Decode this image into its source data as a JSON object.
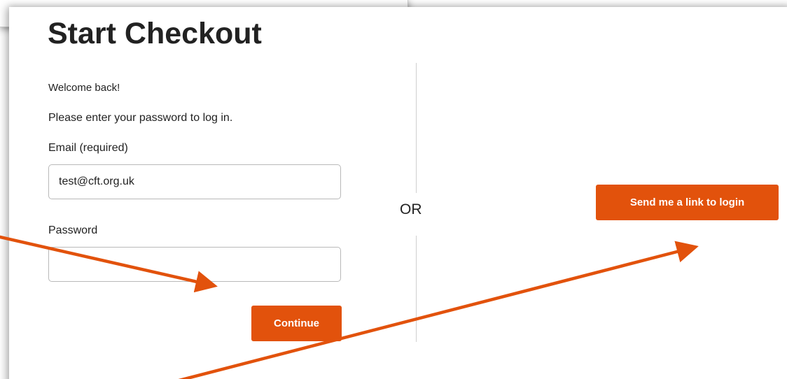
{
  "dialog": {
    "title": "Start Checkout",
    "welcome_text": "Welcome back!",
    "instructions": "Please enter your password to log in."
  },
  "form": {
    "email_label": "Email (required)",
    "email_value": "test@cft.org.uk",
    "password_label": "Password",
    "password_value": "",
    "continue_label": "Continue"
  },
  "divider": {
    "or_text": "OR"
  },
  "alternative": {
    "link_button_label": "Send me a link to login"
  },
  "annotations": {
    "arrow_color": "#e2520c"
  },
  "colors": {
    "accent": "#e2520c",
    "text": "#222222",
    "field_border": "#b9b9b9",
    "divider": "#d0d0d0"
  }
}
